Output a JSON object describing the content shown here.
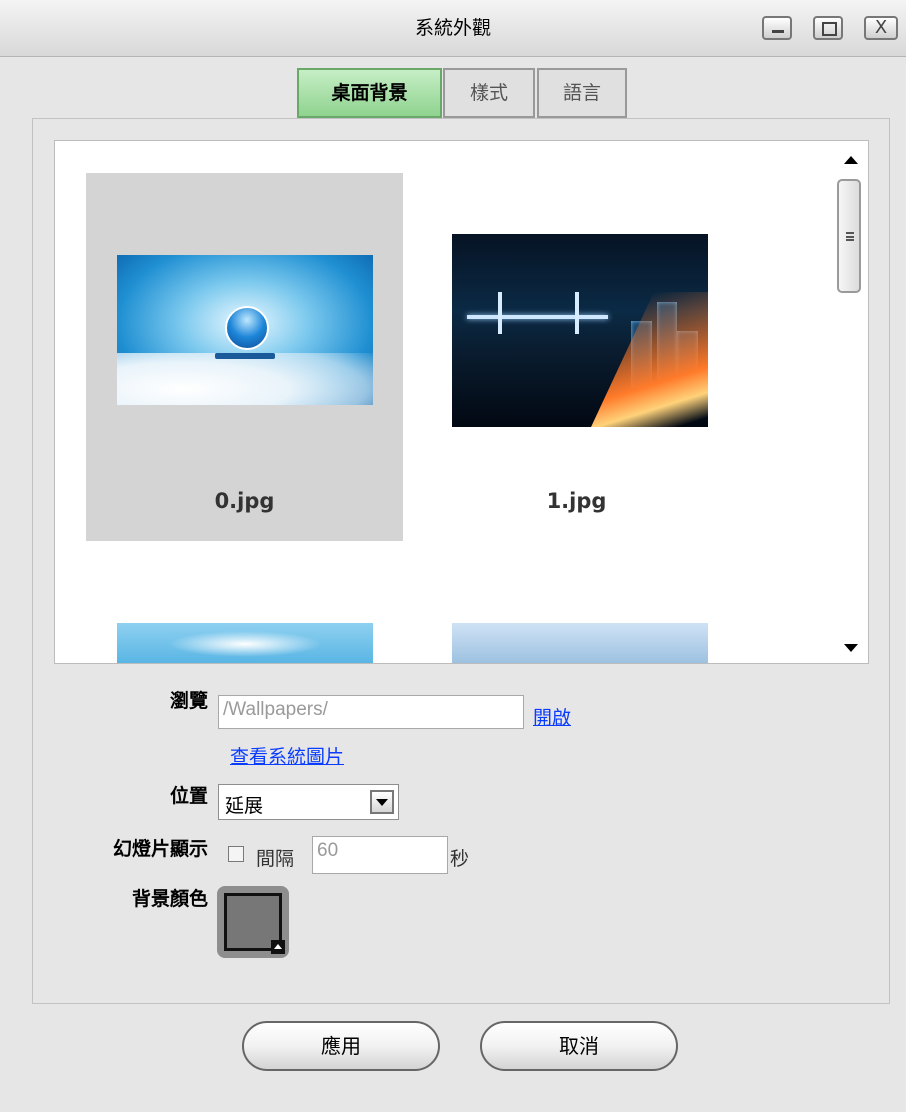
{
  "window": {
    "title": "系統外觀",
    "controls": {
      "minimize": "_",
      "maximize": "□",
      "close": "X"
    }
  },
  "tabs": [
    {
      "label": "桌面背景",
      "active": true
    },
    {
      "label": "樣式",
      "active": false
    },
    {
      "label": "語言",
      "active": false
    }
  ],
  "gallery": {
    "items": [
      {
        "label": "0.jpg",
        "selected": true,
        "image": "sky-logo-wallpaper"
      },
      {
        "label": "1.jpg",
        "selected": false,
        "image": "night-city-bridge-wallpaper"
      },
      {
        "label": "",
        "selected": false,
        "image": "blue-sky-wallpaper-partial"
      },
      {
        "label": "",
        "selected": false,
        "image": "icebergs-wallpaper-partial"
      }
    ]
  },
  "browse": {
    "label": "瀏覽",
    "path": "/Wallpapers/",
    "open_link": "開啟",
    "system_images_link": "查看系統圖片"
  },
  "position": {
    "label": "位置",
    "selected": "延展"
  },
  "slideshow": {
    "label": "幻燈片顯示",
    "checked": false,
    "interval_label": "間隔",
    "interval_value": "60",
    "unit": "秒"
  },
  "background_color": {
    "label": "背景顏色",
    "value": "#777777"
  },
  "buttons": {
    "apply": "應用",
    "cancel": "取消"
  },
  "colors": {
    "active_tab": "#8fd38f",
    "link": "#0a3cff",
    "selection": "#d4d4d4"
  }
}
